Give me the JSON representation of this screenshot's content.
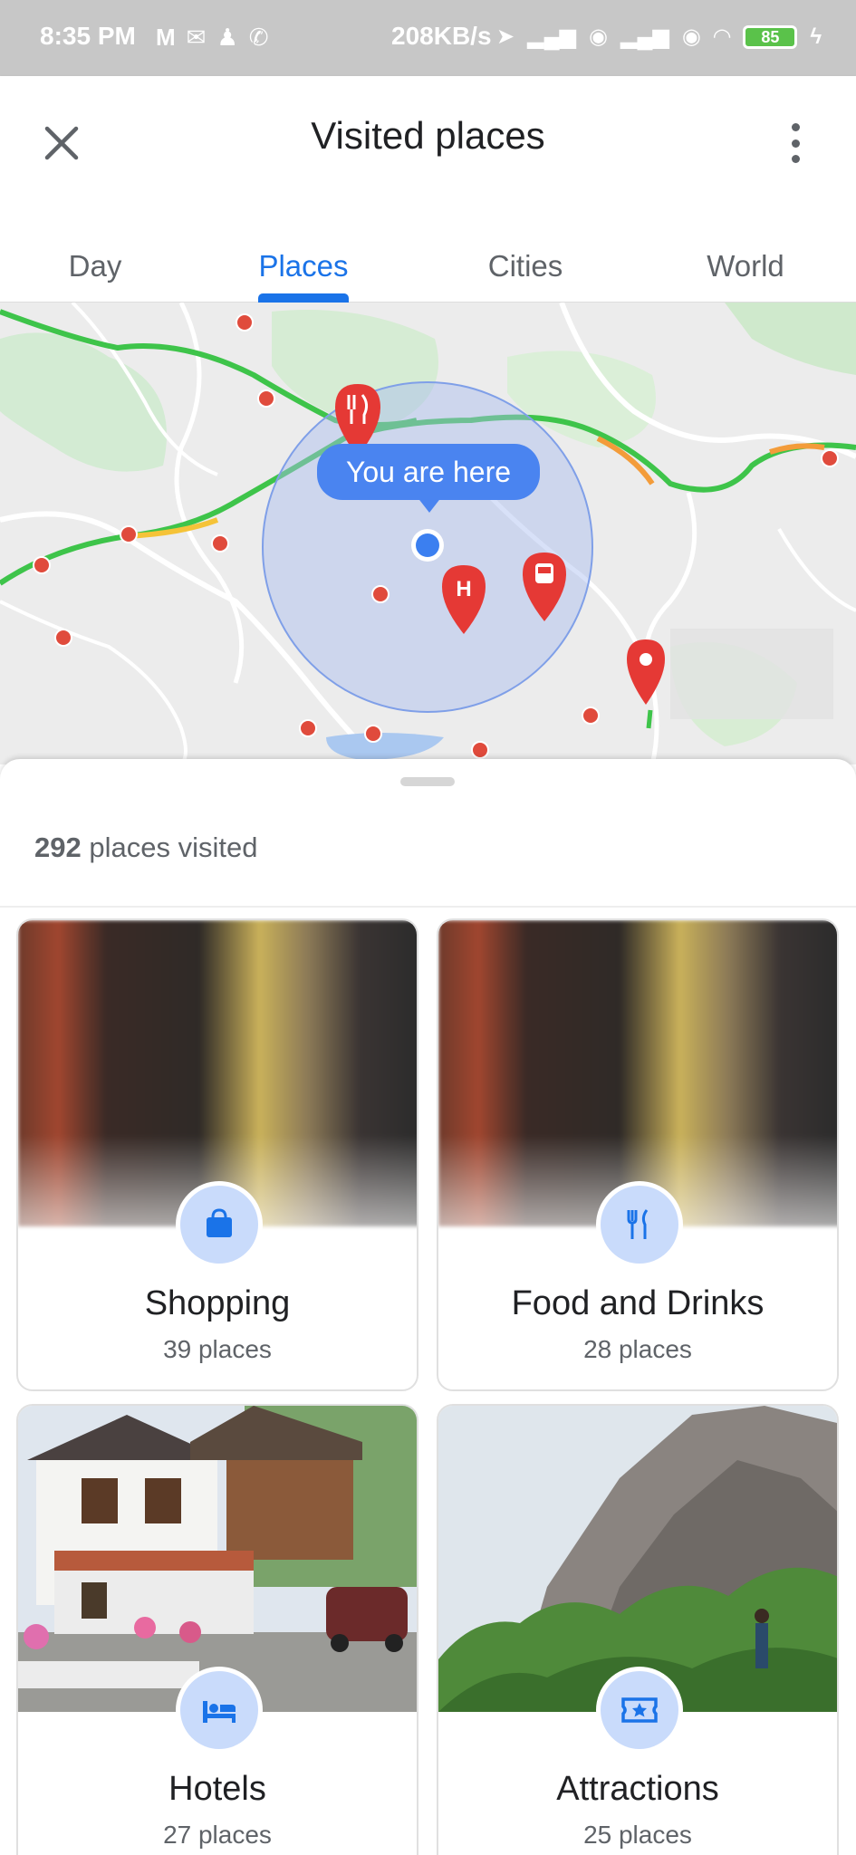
{
  "status_bar": {
    "time": "8:35 PM",
    "network_speed": "208KB/s",
    "battery": "85"
  },
  "header": {
    "title": "Visited places"
  },
  "tabs": [
    {
      "label": "Day",
      "active": false
    },
    {
      "label": "Places",
      "active": true
    },
    {
      "label": "Cities",
      "active": false
    },
    {
      "label": "World",
      "active": false
    }
  ],
  "map": {
    "you_are_here": "You are here"
  },
  "summary": {
    "count": "292",
    "label": "places visited"
  },
  "categories": [
    {
      "name": "Shopping",
      "count": "39 places",
      "icon": "shopping-icon"
    },
    {
      "name": "Food and Drinks",
      "count": "28 places",
      "icon": "food-icon"
    },
    {
      "name": "Hotels",
      "count": "27 places",
      "icon": "bed-icon"
    },
    {
      "name": "Attractions",
      "count": "25 places",
      "icon": "ticket-star-icon"
    }
  ],
  "colors": {
    "accent": "#1a73e8",
    "pin_red": "#e53935",
    "badge_bg": "#c9dbfb"
  }
}
